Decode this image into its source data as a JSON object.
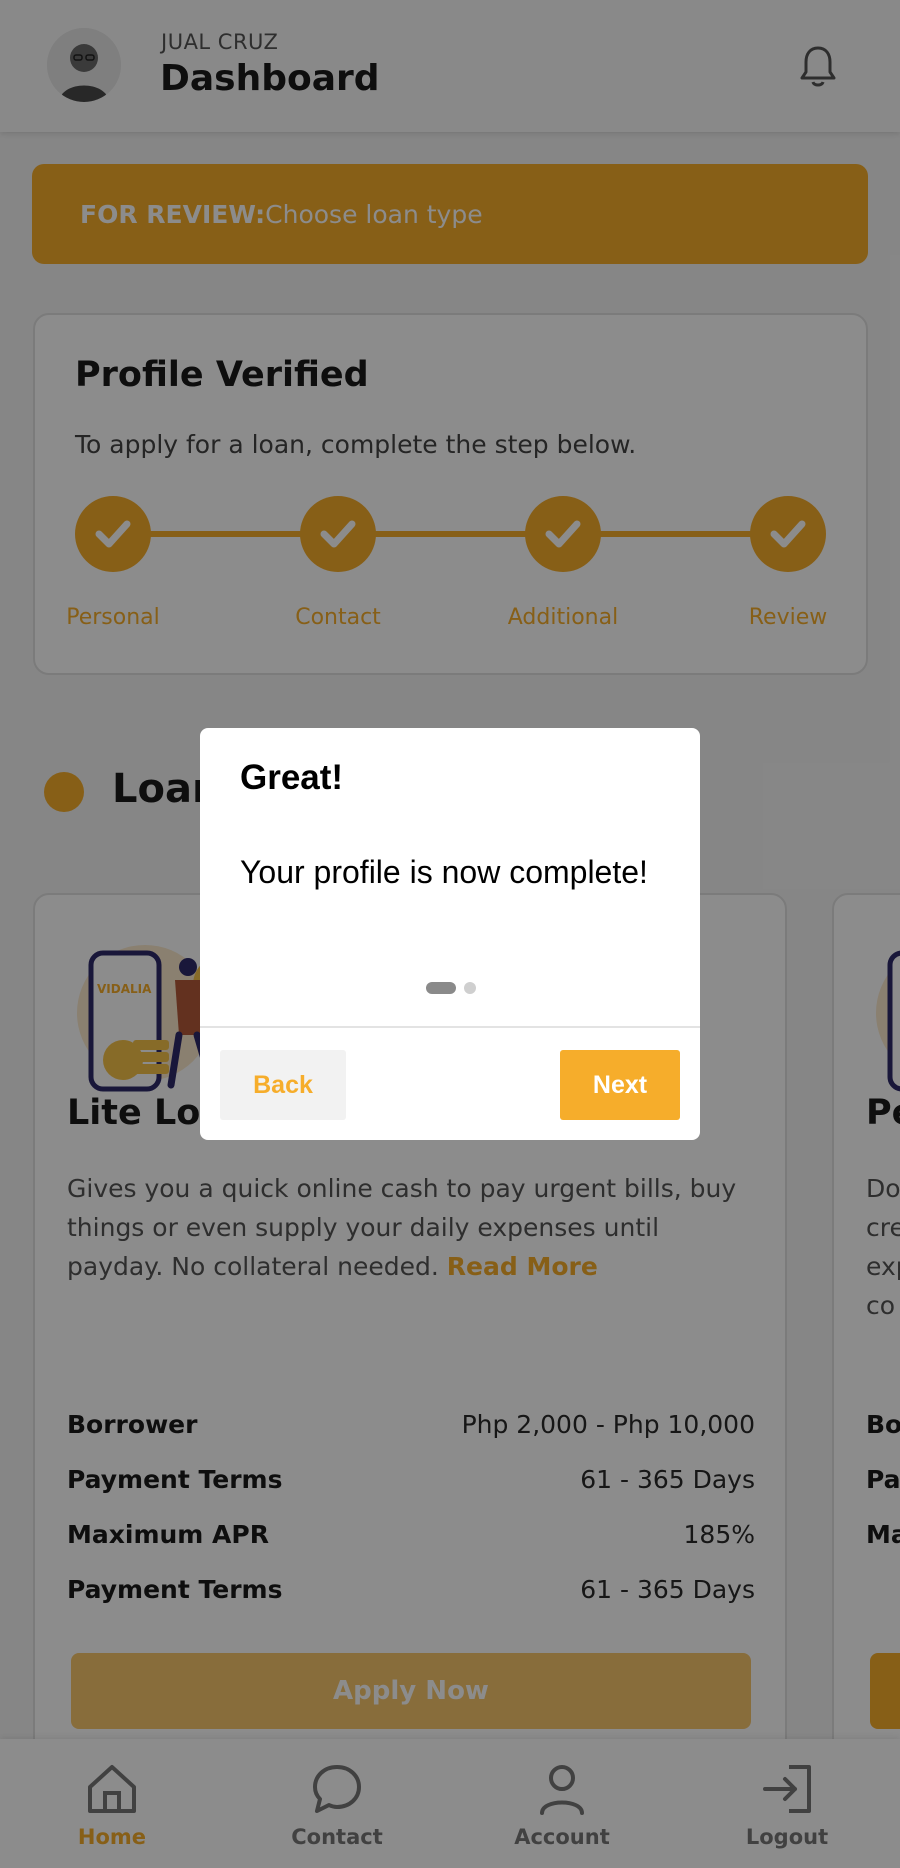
{
  "header": {
    "user_name": "JUAL CRUZ",
    "title": "Dashboard"
  },
  "review_banner": {
    "label": "FOR REVIEW:",
    "text": " Choose loan type"
  },
  "profile_card": {
    "title": "Profile Verified",
    "subtitle": "To apply for a loan, complete the step below.",
    "steps": [
      {
        "label": "Personal",
        "done": true
      },
      {
        "label": "Contact",
        "done": true
      },
      {
        "label": "Additional",
        "done": true
      },
      {
        "label": "Review",
        "done": true
      }
    ]
  },
  "loans_section": {
    "title": "Loan"
  },
  "loan_card": {
    "name": "Lite Loan",
    "description": "Gives you a quick online cash to pay urgent bills, buy things or even supply your daily expenses until payday. No collateral needed. ",
    "read_more": "Read More",
    "specs": [
      {
        "key": "Borrower",
        "value": "Php 2,000 - Php 10,000"
      },
      {
        "key": "Payment Terms",
        "value": "61 - 365 Days"
      },
      {
        "key": "Maximum APR",
        "value": "185%"
      },
      {
        "key": "Payment Terms",
        "value": "61 - 365 Days"
      }
    ],
    "apply_label": "Apply Now"
  },
  "loan_card_2": {
    "name": "Pe",
    "text_lines": [
      "Do",
      "cre",
      "exp",
      "co"
    ],
    "spec_keys": [
      "Bo",
      "Pa",
      "Ma"
    ]
  },
  "bottom_nav": {
    "items": [
      {
        "label": "Home",
        "active": true
      },
      {
        "label": "Contact",
        "active": false
      },
      {
        "label": "Account",
        "active": false
      },
      {
        "label": "Logout",
        "active": false
      }
    ]
  },
  "modal": {
    "title": "Great!",
    "body": "Your profile is now complete!",
    "back_label": "Back",
    "next_label": "Next"
  },
  "colors": {
    "accent": "#f6ad2b",
    "overlay": "rgba(0,0,0,0.45)"
  }
}
